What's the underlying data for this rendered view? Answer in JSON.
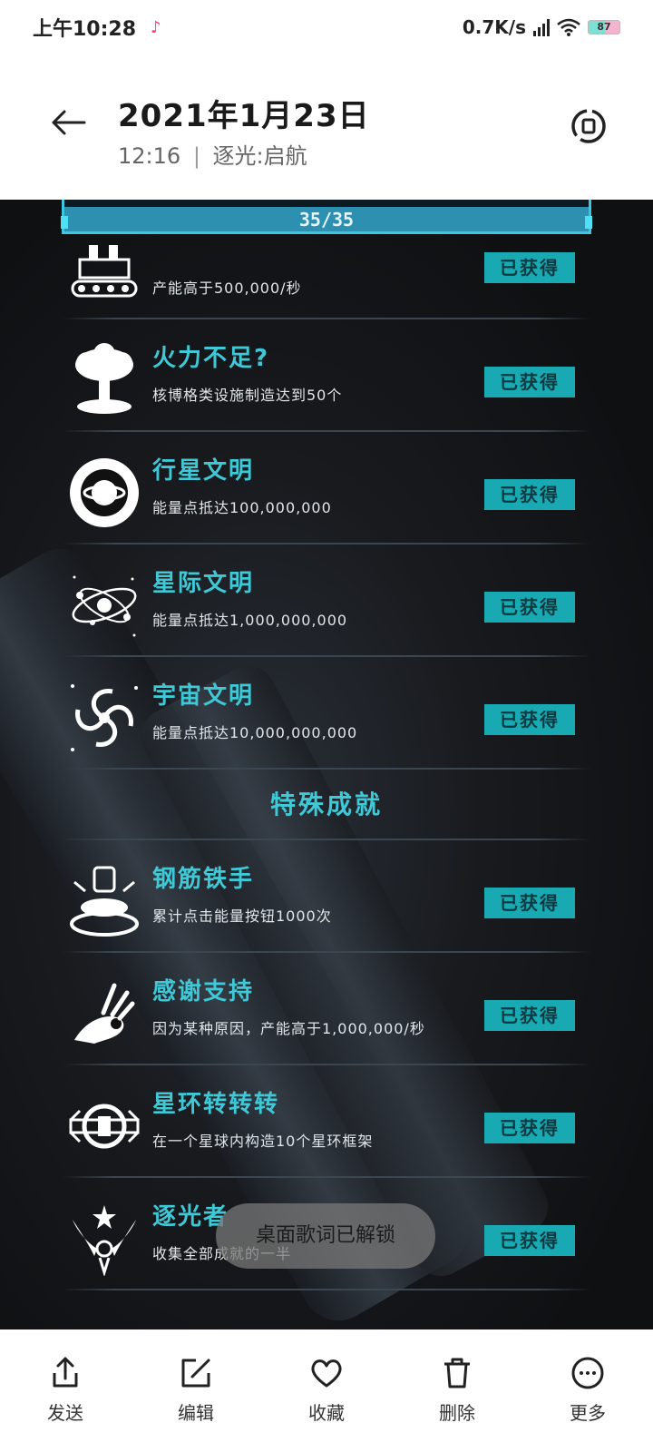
{
  "status_bar": {
    "time": "上午10:28",
    "network_speed": "0.7K/s",
    "battery": "87"
  },
  "header": {
    "title": "2021年1月23日",
    "subtitle_time": "12:16",
    "subtitle_album": "逐光:启航"
  },
  "game": {
    "progress": "35/35",
    "achievements_top": [
      {
        "name": "",
        "desc": "产能高于500,000/秒",
        "status": "已获得",
        "icon": "factory-icon"
      },
      {
        "name": "火力不足?",
        "desc": "核博格类设施制造达到50个",
        "status": "已获得",
        "icon": "mushroom-cloud-icon"
      },
      {
        "name": "行星文明",
        "desc": "能量点抵达100,000,000",
        "status": "已获得",
        "icon": "planet-icon"
      },
      {
        "name": "星际文明",
        "desc": "能量点抵达1,000,000,000",
        "status": "已获得",
        "icon": "orbit-icon"
      },
      {
        "name": "宇宙文明",
        "desc": "能量点抵达10,000,000,000",
        "status": "已获得",
        "icon": "galaxy-icon"
      }
    ],
    "section_special": "特殊成就",
    "achievements_special": [
      {
        "name": "钢筋铁手",
        "desc": "累计点击能量按钮1000次",
        "status": "已获得",
        "icon": "press-button-icon"
      },
      {
        "name": "感谢支持",
        "desc": "因为某种原因，产能高于1,000,000/秒",
        "status": "已获得",
        "icon": "ok-hand-icon"
      },
      {
        "name": "星环转转转",
        "desc": "在一个星球内构造10个星环框架",
        "status": "已获得",
        "icon": "ring-station-icon"
      },
      {
        "name": "逐光者",
        "desc": "收集全部成就的一半",
        "status": "已获得",
        "icon": "winged-emblem-icon"
      }
    ]
  },
  "toast": "桌面歌词已解锁",
  "toolbar": {
    "send": "发送",
    "edit": "编辑",
    "favorite": "收藏",
    "delete": "删除",
    "more": "更多"
  }
}
